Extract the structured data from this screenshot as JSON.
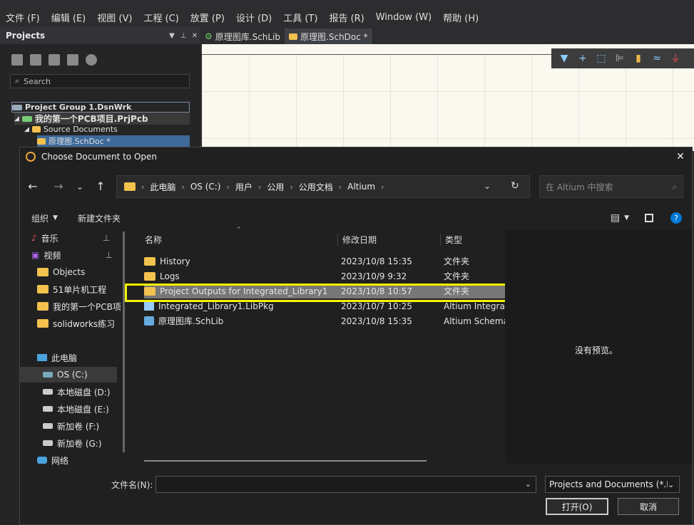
{
  "menu": [
    "文件 (F)",
    "编辑 (E)",
    "视图 (V)",
    "工程 (C)",
    "放置 (P)",
    "设计 (D)",
    "工具 (T)",
    "报告 (R)",
    "Window (W)",
    "帮助 (H)"
  ],
  "panel": {
    "title": "Projects",
    "search_placeholder": "Search",
    "tree": {
      "group": "Project Group 1.DsnWrk",
      "project": "我的第一个PCB项目.PrjPcb",
      "folder": "Source Documents",
      "doc": "原理图.SchDoc *"
    }
  },
  "doc_tabs": [
    "原理图库.SchLib",
    "原理图.SchDoc *"
  ],
  "dialog": {
    "title": "Choose Document to Open",
    "breadcrumb": [
      "此电脑",
      "OS (C:)",
      "用户",
      "公用",
      "公用文档",
      "Altium"
    ],
    "search_placeholder": "在 Altium 中搜索",
    "organize": "组织",
    "new_folder": "新建文件夹",
    "sidebar": [
      {
        "label": "音乐",
        "icon": "music-icon",
        "pinned": true
      },
      {
        "label": "视频",
        "icon": "video-icon",
        "pinned": true
      },
      {
        "label": "Objects",
        "icon": "folder-icon"
      },
      {
        "label": "51单片机工程",
        "icon": "folder-icon"
      },
      {
        "label": "我的第一个PCB项",
        "icon": "folder-icon"
      },
      {
        "label": "solidworks练习",
        "icon": "folder-icon"
      },
      {
        "label": "此电脑",
        "icon": "computer-icon"
      },
      {
        "label": "OS (C:)",
        "icon": "drive-icon",
        "selected": true
      },
      {
        "label": "本地磁盘 (D:)",
        "icon": "drive-icon"
      },
      {
        "label": "本地磁盘 (E:)",
        "icon": "drive-icon"
      },
      {
        "label": "新加卷 (F:)",
        "icon": "drive-icon"
      },
      {
        "label": "新加卷 (G:)",
        "icon": "drive-icon"
      },
      {
        "label": "网络",
        "icon": "network-icon"
      }
    ],
    "columns": {
      "name": "名称",
      "date": "修改日期",
      "type": "类型"
    },
    "files": [
      {
        "name": "History",
        "date": "2023/10/8 15:35",
        "type": "文件夹",
        "icon": "folder-icon"
      },
      {
        "name": "Logs",
        "date": "2023/10/9 9:32",
        "type": "文件夹",
        "icon": "folder-icon"
      },
      {
        "name": "Project Outputs for Integrated_Library1",
        "date": "2023/10/8 10:57",
        "type": "文件夹",
        "icon": "folder-icon",
        "selected": true
      },
      {
        "name": "Integrated_Library1.LibPkg",
        "date": "2023/10/7 10:25",
        "type": "Altium Integra",
        "icon": "libpkg-icon"
      },
      {
        "name": "原理图库.SchLib",
        "date": "2023/10/8 15:35",
        "type": "Altium Schema",
        "icon": "schlib-icon"
      }
    ],
    "no_preview": "没有预览。",
    "filename_label": "文件名(N):",
    "filename_value": "",
    "filetype": "Projects and Documents (*.D",
    "open_label": "打开(O)",
    "cancel_label": "取消"
  },
  "colors": {
    "highlight": "#f4f400",
    "accent": "#0078d4",
    "folder": "#f2c14e"
  }
}
